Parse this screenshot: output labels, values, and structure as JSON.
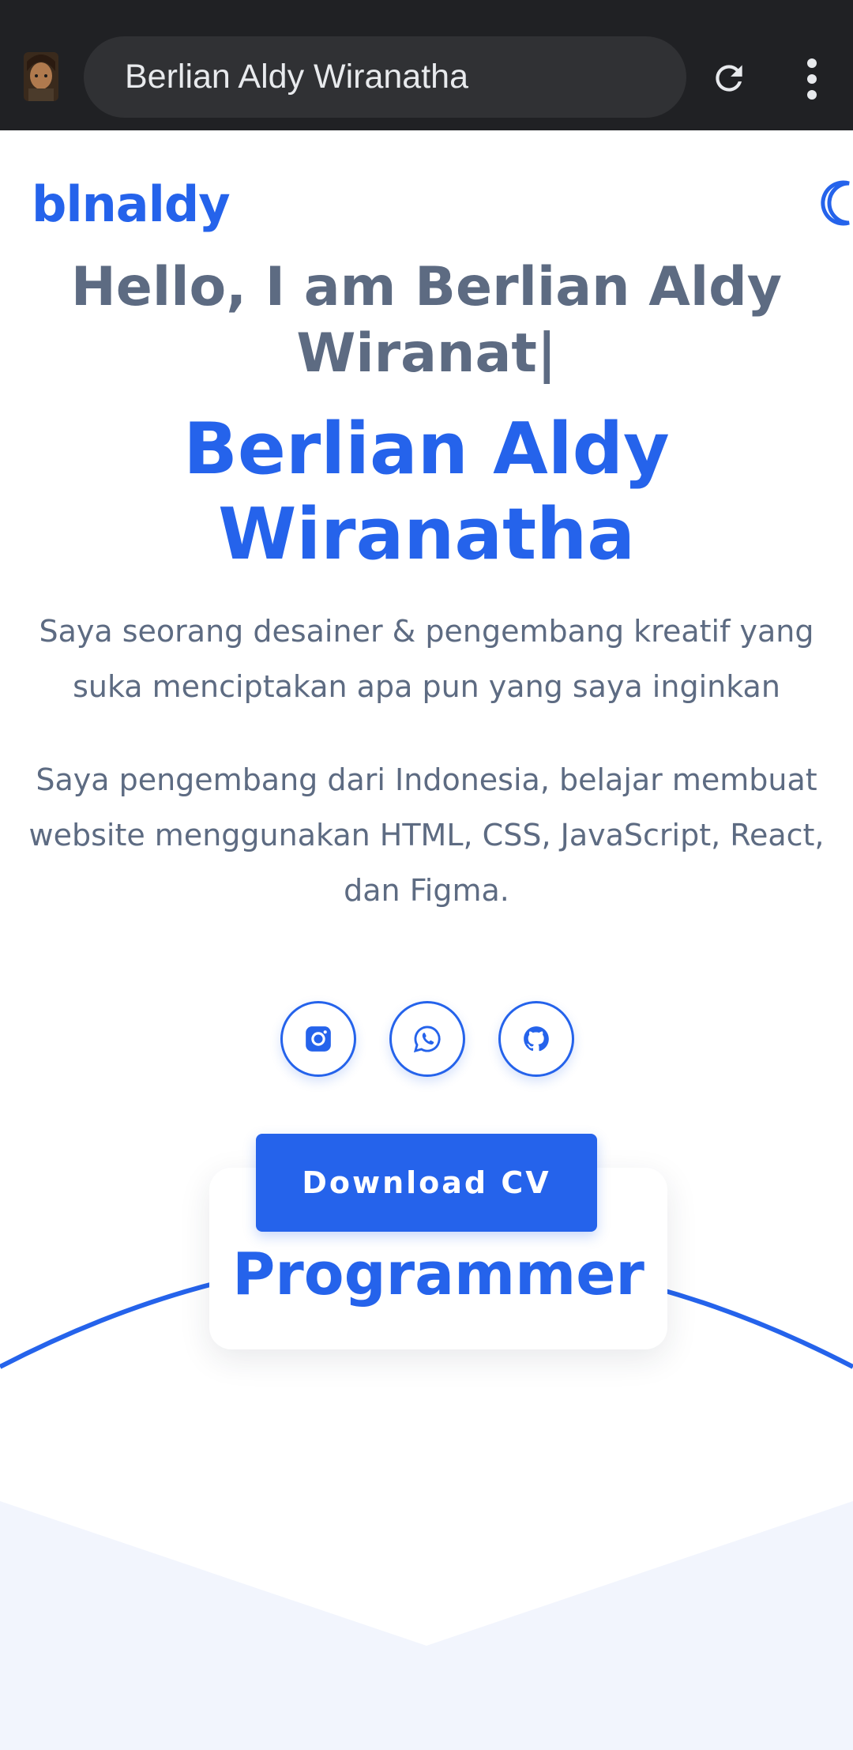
{
  "browser": {
    "url_title": "Berlian Aldy Wiranatha",
    "reload_icon": "reload-icon",
    "menu_icon": "more-vert-icon"
  },
  "header": {
    "brand": "blnaldy",
    "theme_icon": "moon-icon"
  },
  "hero": {
    "greeting": "Hello, I am Berlian Aldy Wiranat|",
    "name": "Berlian Aldy Wiranatha",
    "intro": "Saya seorang desainer & pengembang kreatif yang suka menciptakan apa pun yang saya inginkan",
    "about": "Saya pengembang dari Indonesia, belajar membuat website menggunakan HTML, CSS, JavaScript, React, dan Figma."
  },
  "socials": [
    {
      "icon": "instagram-icon"
    },
    {
      "icon": "whatsapp-icon"
    },
    {
      "icon": "github-icon"
    }
  ],
  "cta": {
    "download_label": "Download CV"
  },
  "role": {
    "label": "Programmer"
  },
  "colors": {
    "accent": "#2563eb",
    "text_muted": "#5d6b82",
    "chrome_bg": "#202124",
    "urlbar_bg": "#303134",
    "section_bg": "#f2f5fd"
  }
}
